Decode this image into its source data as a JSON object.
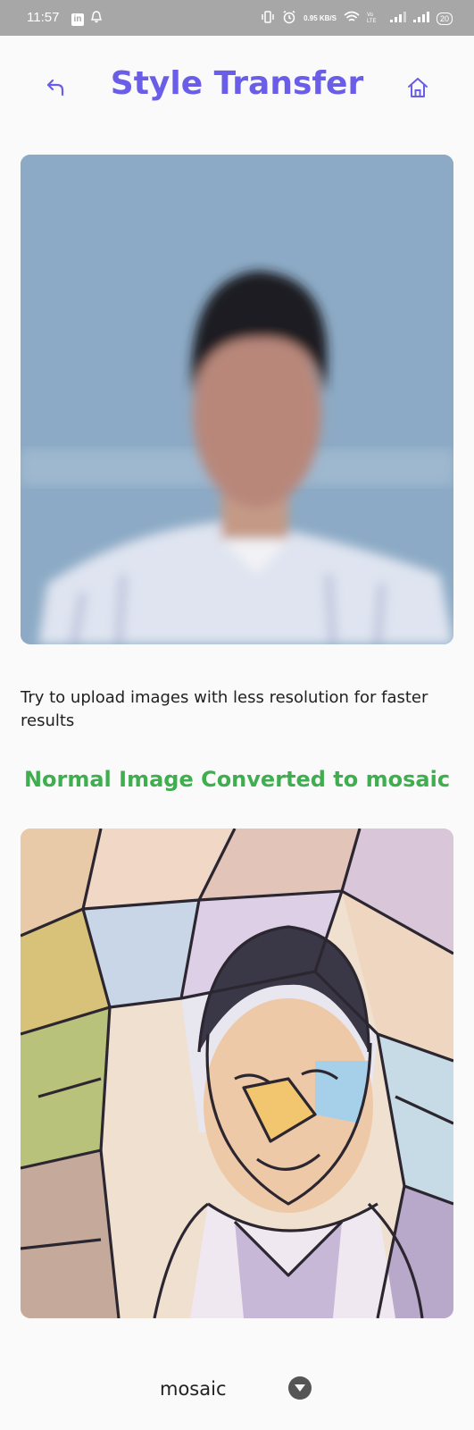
{
  "status_bar": {
    "time": "11:57",
    "net_speed": "0.95 KB/S",
    "battery": "20",
    "icons": [
      "linkedin-icon",
      "notification-bell-icon",
      "vibrate-icon",
      "alarm-icon",
      "wifi-icon",
      "volte-icon",
      "signal-icon",
      "battery-icon"
    ]
  },
  "header": {
    "title": "Style Transfer",
    "back_icon": "undo-arrow-icon",
    "home_icon": "home-icon"
  },
  "colors": {
    "title": "#6a5ee8",
    "caption": "#3fae4e",
    "status_bar": "#a7a7a7"
  },
  "hint": "Try to upload images with less resolution for faster results",
  "result_caption": "Normal Image Converted to mosaic",
  "style_select": {
    "value": "mosaic",
    "icon": "dropdown-arrow-icon"
  }
}
